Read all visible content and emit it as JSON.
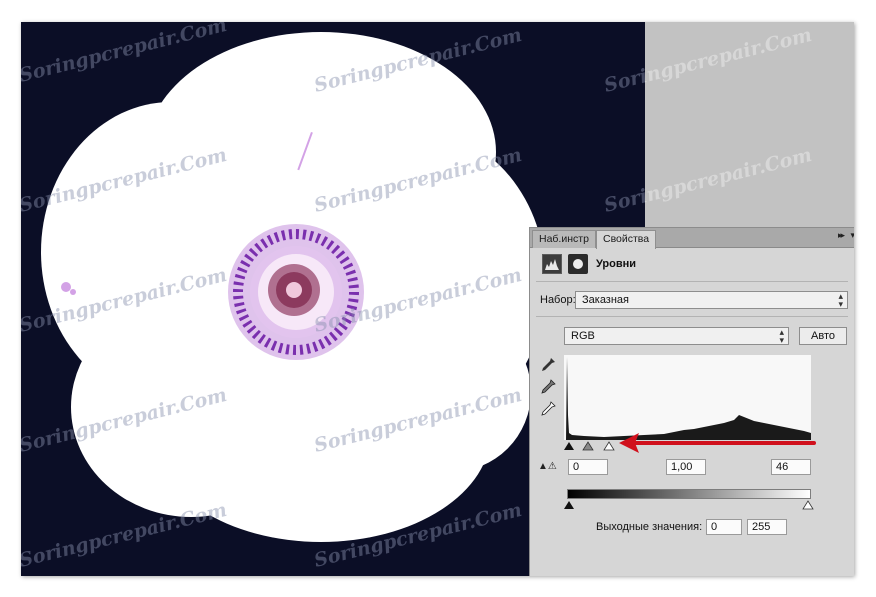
{
  "watermark_text": "Soringpcrepair.Com",
  "panel": {
    "tabs": [
      "Наб.инстр",
      "Свойства"
    ],
    "collapse_glyph": "▸▸",
    "menu_glyph": "▾",
    "title": "Уровни",
    "preset": {
      "label": "Набор:",
      "value": "Заказная"
    },
    "channel": {
      "value": "RGB"
    },
    "auto_button": "Авто",
    "input_levels": {
      "black": "0",
      "gamma": "1,00",
      "white": "46"
    },
    "output_levels": {
      "label": "Выходные значения:",
      "black": "0",
      "white": "255"
    }
  },
  "colors": {
    "canvas_background": "#0b0e26",
    "workspace_gray": "#c2c2c2",
    "panel_background": "#d6d6d6",
    "annotation_arrow": "#d0101c",
    "flower_center": "#c86fd6"
  },
  "icons": [
    "levels-histogram-icon",
    "mask-icon",
    "black-point-eyedropper-icon",
    "gray-point-eyedropper-icon",
    "white-point-eyedropper-icon",
    "clipping-warning-icon"
  ]
}
